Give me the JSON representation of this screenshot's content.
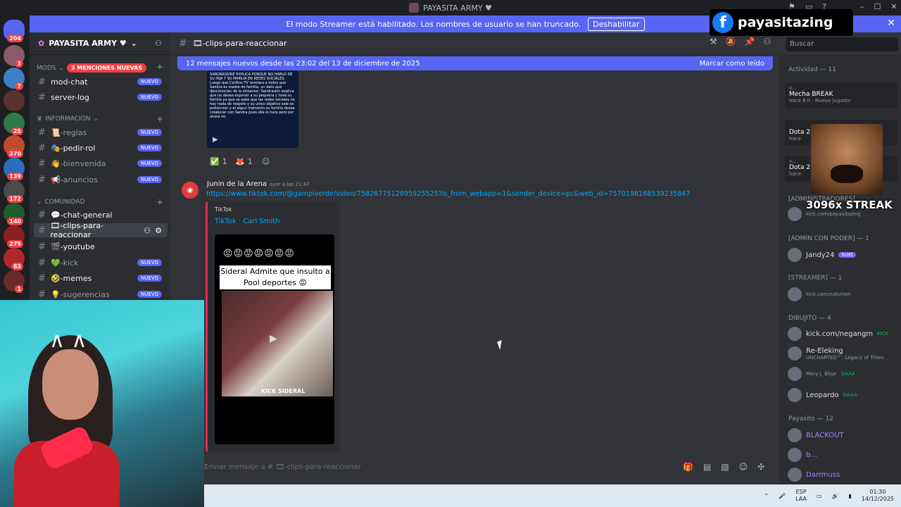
{
  "window": {
    "title": "PAYASITA ARMY ♥"
  },
  "banner": {
    "text": "El modo Streamer está habilitado. Los nombres de usuario se han truncado.",
    "button": "Deshabilitar",
    "close": "✕"
  },
  "rail": {
    "badges": [
      "204",
      "3",
      "7",
      "25",
      "370",
      "139",
      "172",
      "140",
      "275",
      "83",
      "1"
    ]
  },
  "sidebar": {
    "guild_name": "PAYASITA ARMY ♥",
    "categories": {
      "mods": "MODS",
      "mentions": "3 MENCIONES NUEVAS",
      "info": "INFORMACION",
      "community": "COMUNIDAD"
    },
    "nuevo": "NUEVO",
    "channels": {
      "mod_chat": "mod-chat",
      "server_log": "server-log",
      "reglas": "📜-reglas",
      "pedir_rol": "🎭-pedir-rol",
      "bienvenida": "👋-bienvenida",
      "anuncios": "📢-anuncios",
      "chat_general": "💬-chat-general",
      "clips": "🎞-clips-para-reaccionar",
      "youtube": "🎬-youtube",
      "kick": "💚-kick",
      "memes": "🤣-memes",
      "sugerencias": "💡-sugerencias"
    }
  },
  "header": {
    "channel": "🎞-clips-para-reaccionar",
    "search_placeholder": "Buscar"
  },
  "newbar": {
    "text": "12 mensajes nuevos desde las 23:02 del 13 de diciembre de 2025",
    "action": "Marcar como leído"
  },
  "thumb_text": "SANDRASKINE EXPLICA PORQUE NO HABLO DE SU HIJA Y SU FAMILIA EN REDES SOCIALES. Luego que Carlitos TV revelara a todos que Sandra es madre de familia, un dato que desconocian de la streamer, Sandraskin explica que no desea exponer a su pequena y toda su familia ya que se sabe que las redes sociales no hay nada de respeto y su unico objetivo sale es proteccion y el algun momento su familia desea colaborar con Sandra pues ella lo hara pero por ahora no.",
  "reactions": [
    {
      "emoji": "✅",
      "count": "1"
    },
    {
      "emoji": "🦊",
      "count": "1"
    }
  ],
  "message": {
    "author": "Junin de la Arena",
    "timestamp": "ayer a las 21:47",
    "link": "https://www.tiktok.com/@gampiverde/video/7582677512895925525?is_from_webapp=1&sender_device=pc&web_id=7570198168539235847",
    "embed_provider": "TikTok",
    "embed_title": "TikTok · Carl Smith",
    "video_emojis": "😡😡😡😡😡😡😡",
    "video_caption": "Sideral Admite que insulto a Pool deportes 😡",
    "video_brand": "KICK SIDERAL"
  },
  "composer": {
    "placeholder": "Enviar mensaje a # 🎞-clips-para-reaccionar"
  },
  "members": {
    "activity_header": "Actividad — 11",
    "activities": [
      {
        "name": "Mecha BREAK",
        "sub": "hace 8 h · Nuevo jugador",
        "label": "v..."
      },
      {
        "name": "Dota 2",
        "sub": "hace",
        "label": ""
      },
      {
        "name": "Dota 2",
        "sub": "hace",
        "label": "v..."
      }
    ],
    "groups": [
      {
        "title": "[ADMINISTRADORES]",
        "members": [
          {
            "name": "",
            "sub": "kick.com/payasitazing"
          }
        ]
      },
      {
        "title": "[ADMIN CON PODER] — 1",
        "members": [
          {
            "name": "Jandy24",
            "tag": "SUKI"
          }
        ]
      },
      {
        "title": "[STREAMER] — 1",
        "members": [
          {
            "name": "",
            "sub": "kick.com/naturion"
          }
        ]
      },
      {
        "title": "DIBUJITO — 4",
        "members": [
          {
            "name": "kick.com/negangm",
            "tag": "KICK"
          },
          {
            "name": "Re-Eleking",
            "sub": "UNCHARTED™: Legacy of Thiev..."
          },
          {
            "name": "",
            "tag": "GAAA",
            "sub": "Mary J. Blige"
          },
          {
            "name": "Leopardo",
            "tag": "GAAA"
          }
        ]
      },
      {
        "title": "Payasito — 12",
        "members": [
          {
            "name": "BLACKOUT"
          },
          {
            "name": "b..."
          },
          {
            "name": "Darrmuss"
          }
        ]
      }
    ]
  },
  "overlay": {
    "brand": "payasitazing",
    "streak": "3096x STREAK"
  },
  "taskbar": {
    "lang": "ESP",
    "region": "LAA",
    "time": "01:30",
    "date": "14/12/2025"
  }
}
